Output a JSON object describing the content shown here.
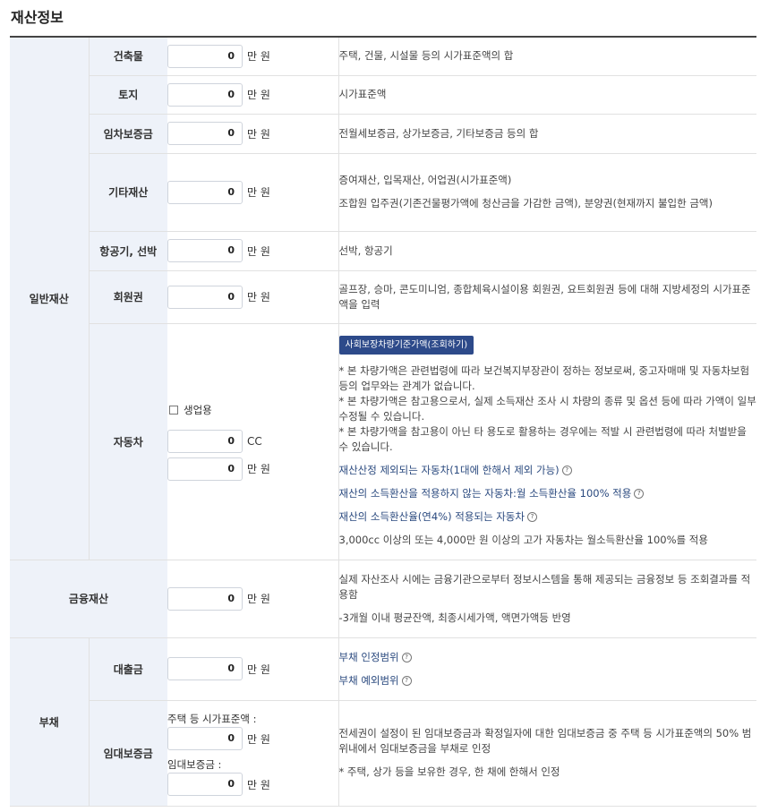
{
  "page": {
    "title": "재산정보"
  },
  "general": {
    "label": "일반재산",
    "building": {
      "label": "건축물",
      "value": "0",
      "unit": "만 원",
      "desc": "주택, 건물, 시설물 등의 시가표준액의 합"
    },
    "land": {
      "label": "토지",
      "value": "0",
      "unit": "만 원",
      "desc": "시가표준액"
    },
    "lease_deposit": {
      "label": "임차보증금",
      "value": "0",
      "unit": "만 원",
      "desc": "전월세보증금, 상가보증금, 기타보증금 등의 합"
    },
    "other": {
      "label": "기타재산",
      "value": "0",
      "unit": "만 원",
      "desc1": "증여재산, 입목재산, 어업권(시가표준액)",
      "desc2": "조합원 입주권(기존건물평가액에 청산금을 가감한 금액), 분양권(현재까지 불입한 금액)"
    },
    "aircraft": {
      "label": "항공기, 선박",
      "value": "0",
      "unit": "만 원",
      "desc": "선박, 항공기"
    },
    "membership": {
      "label": "회원권",
      "value": "0",
      "unit": "만 원",
      "desc": "골프장, 승마, 콘도미니엄, 종합체육시설이용 회원권, 요트회원권 등에 대해 지방세정의 시가표준액을 입력"
    },
    "car": {
      "label": "자동차",
      "business_checkbox": "생업용",
      "cc_value": "0",
      "cc_unit": "CC",
      "value": "0",
      "unit": "만 원",
      "price_button": "사회보장차량기준가액(조회하기)",
      "notes": [
        "* 본 차량가액은 관련법령에 따라 보건복지부장관이 정하는 정보로써, 중고자매매 및 자동차보험 등의 업무와는 관계가 없습니다.",
        "* 본 차량가액은 참고용으로서, 실제 소득재산 조사 시 차량의 종류 및 옵션 등에 따라 가액이 일부 수정될 수 있습니다.",
        "* 본 차량가액을 참고용이 아닌 타 용도로 활용하는 경우에는 적발 시 관련법령에 따라 처벌받을 수 있습니다."
      ],
      "link1": "재산산정 제외되는 자동차(1대에 한해서 제외 가능)",
      "link2": "재산의 소득환산을 적용하지 않는 자동차:월 소득환산율 100% 적용",
      "link3": "재산의 소득환산율(연4%) 적용되는 자동차",
      "note_last": "3,000cc 이상의 또는 4,000만 원 이상의 고가 자동차는 월소득환산율 100%를 적용"
    }
  },
  "financial": {
    "label": "금융재산",
    "value": "0",
    "unit": "만 원",
    "desc1": "실제 자산조사 시에는 금융기관으로부터 정보시스템을 통해 제공되는 금융정보 등 조회결과를 적용함",
    "desc2": "-3개월 이내 평균잔액, 최종시세가액, 액면가액등 반영"
  },
  "debt": {
    "label": "부채",
    "loan": {
      "label": "대출금",
      "value": "0",
      "unit": "만 원",
      "link1": "부채 인정범위",
      "link2": "부채 예외범위"
    },
    "lease": {
      "label": "임대보증금",
      "price_label": "주택 등 시가표준액 :",
      "price_value": "0",
      "price_unit": "만 원",
      "deposit_label": "임대보증금 :",
      "deposit_value": "0",
      "deposit_unit": "만 원",
      "desc1": "전세권이 설정이 된 임대보증금과 확정일자에 대한 임대보증금 중 주택 등 시가표준액의 50% 범위내에서 임대보증금을 부채로 인정",
      "desc2": "* 주택, 상가 등을 보유한 경우, 한 채에 한해서 인정"
    }
  },
  "icons": {
    "help": "question-circle-icon",
    "checkbox": "checkbox-icon"
  }
}
